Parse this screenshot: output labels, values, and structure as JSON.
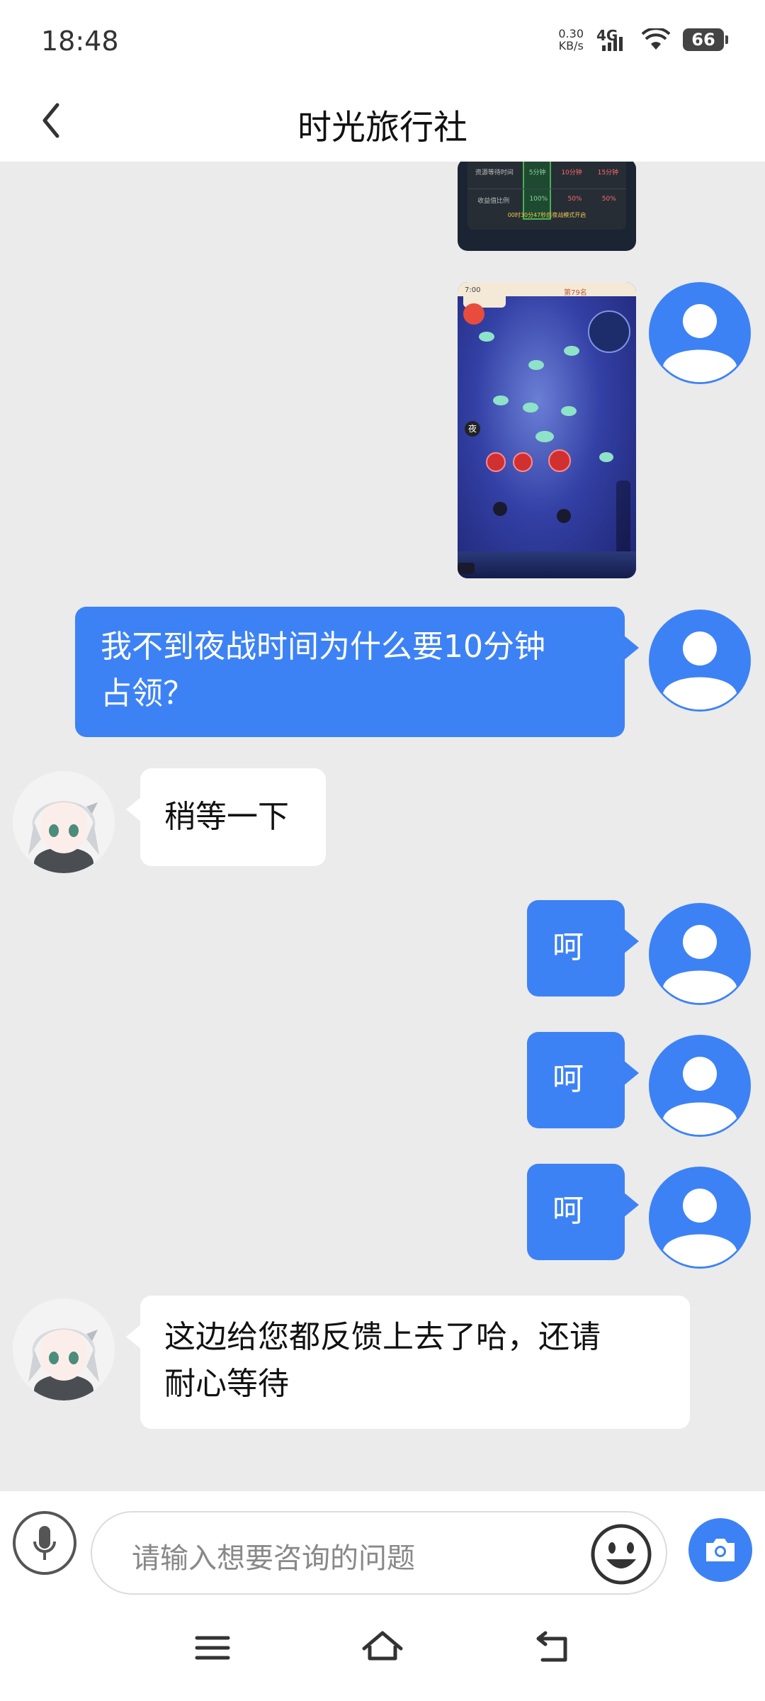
{
  "status_bar": {
    "time": "18:48",
    "net_speed_value": "0.30",
    "net_speed_unit": "KB/s",
    "network_type": "4G",
    "battery": "66"
  },
  "header": {
    "title": "时光旅行社",
    "back_icon": "chevron-left-icon"
  },
  "messages": [
    {
      "side": "out",
      "type": "image",
      "description_icon": "image"
    },
    {
      "side": "out",
      "type": "image",
      "description_icon": "image"
    },
    {
      "side": "out",
      "type": "text",
      "line1": "我不到夜战时间为什么要10分钟",
      "line2": "占领？"
    },
    {
      "side": "in",
      "type": "text",
      "text": "稍等一下"
    },
    {
      "side": "out",
      "type": "text",
      "text": "呵"
    },
    {
      "side": "out",
      "type": "text",
      "text": "呵"
    },
    {
      "side": "out",
      "type": "text",
      "text": "呵"
    },
    {
      "side": "in",
      "type": "text",
      "line1": "这边给您都反馈上去了哈，还请",
      "line2": "耐心等待"
    }
  ],
  "screenshot_top": {
    "row1": [
      "资源等待时间",
      "5分钟",
      "10分钟",
      "15分钟"
    ],
    "row2": [
      "收益值比例",
      "100%",
      "50%",
      "50%"
    ],
    "footer": "00时30分47秒后夜战模式开启"
  },
  "screenshot_game": {
    "top_label": "7:00",
    "top_right": "第79名",
    "side_label": "夜"
  },
  "input_bar": {
    "placeholder": "请输入想要咨询的问题"
  },
  "colors": {
    "accent": "#3d82f5",
    "background": "#ebebeb"
  }
}
